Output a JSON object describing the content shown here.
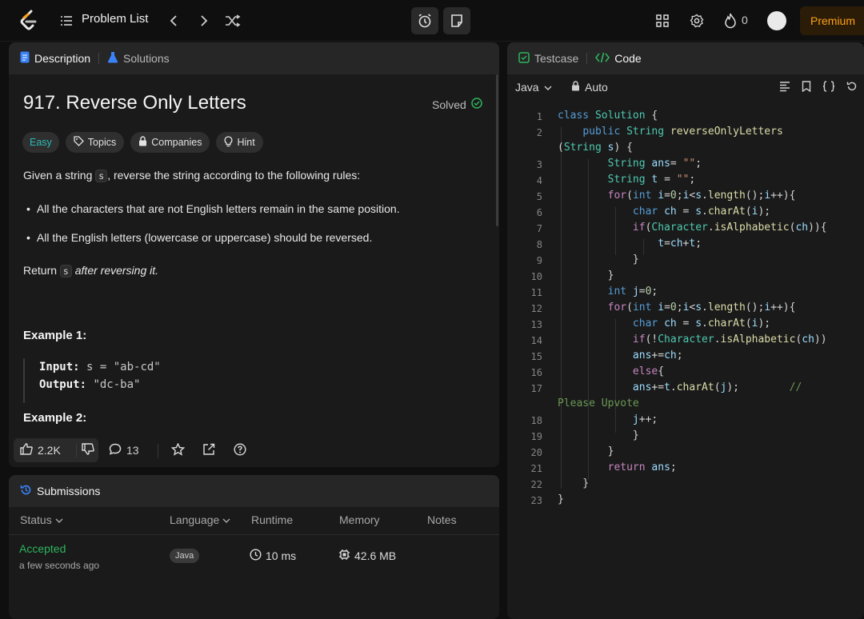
{
  "topbar": {
    "problem_list_label": "Problem List",
    "fire_count": "0",
    "premium_label": "Premium"
  },
  "description_panel": {
    "tab_description": "Description",
    "tab_solutions": "Solutions",
    "title": "917. Reverse Only Letters",
    "status": "Solved",
    "tags": [
      "Easy",
      "Topics",
      "Companies",
      "Hint"
    ],
    "intro_before": "Given a string",
    "intro_code": "s",
    "intro_after": ", reverse the string according to the following rules:",
    "rules": [
      "All the characters that are not English letters remain in the same position.",
      "All the English letters (lowercase or uppercase) should be reversed."
    ],
    "return_before": "Return",
    "return_code": "s",
    "return_after": "after reversing it.",
    "example1_title": "Example 1:",
    "example1_input_label": "Input:",
    "example1_input_value": "s = \"ab-cd\"",
    "example1_output_label": "Output:",
    "example1_output_value": "\"dc-ba\"",
    "example2_title": "Example 2:",
    "likes": "2.2K",
    "comments": "13"
  },
  "submissions_panel": {
    "title": "Submissions",
    "columns": [
      "Status",
      "Language",
      "Runtime",
      "Memory",
      "Notes"
    ],
    "rows": [
      {
        "status": "Accepted",
        "time_ago": "a few seconds ago",
        "language": "Java",
        "runtime": "10 ms",
        "memory": "42.6 MB"
      }
    ]
  },
  "code_panel": {
    "tab_testcase": "Testcase",
    "tab_code": "Code",
    "language": "Java",
    "mode": "Auto",
    "line_numbers": [
      "1",
      "2",
      "",
      "3",
      "4",
      "5",
      "6",
      "7",
      "8",
      "9",
      "10",
      "11",
      "12",
      "13",
      "14",
      "15",
      "16",
      "17",
      "",
      "18",
      "19",
      "20",
      "21",
      "22",
      "23"
    ]
  },
  "colors": {
    "accent": "#ffa116",
    "easy": "#2cbbb7",
    "accepted": "#2db55d",
    "panel_bg": "#1a1a1a",
    "page_bg": "#0f0f0f"
  }
}
